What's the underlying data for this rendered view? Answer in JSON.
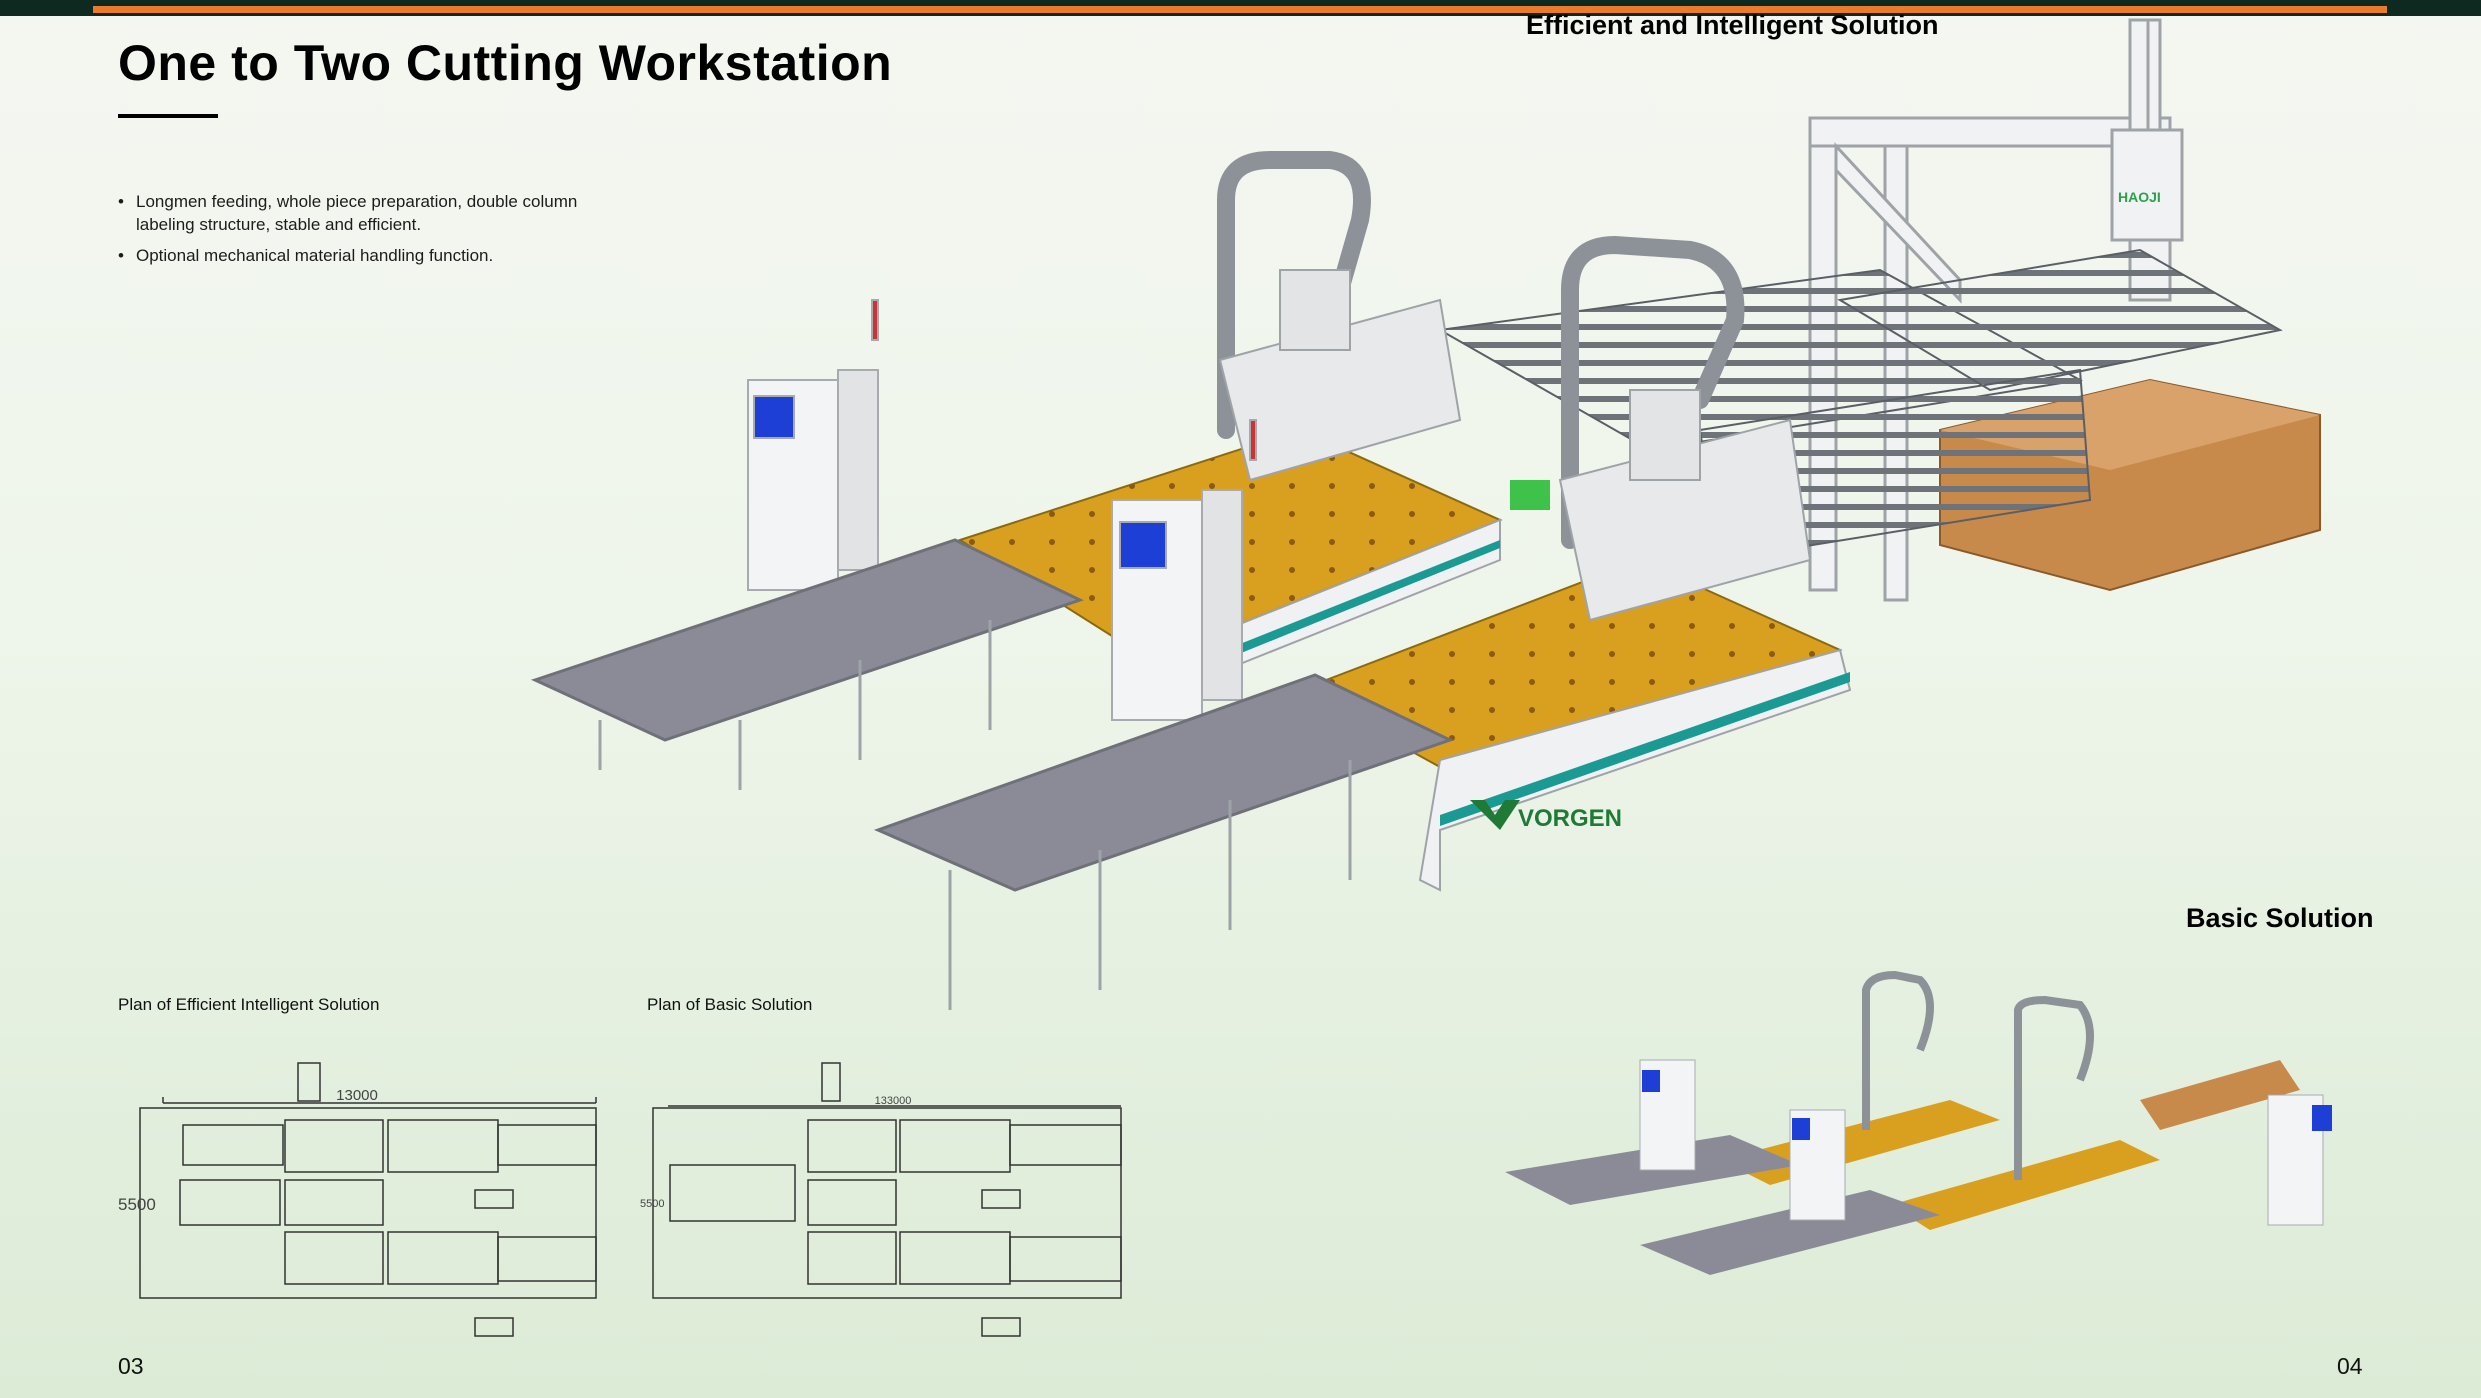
{
  "title": "One to Two Cutting Workstation",
  "bullets": [
    "Longmen feeding, whole piece preparation, double column labeling structure, stable and efficient.",
    "Optional mechanical material handling function."
  ],
  "solutions": {
    "efficient_title": "Efficient and Intelligent Solution",
    "basic_title": "Basic Solution"
  },
  "plans": {
    "efficient": {
      "label": "Plan of Efficient Intelligent Solution",
      "length_dim": "13000",
      "width_dim": "5500"
    },
    "basic": {
      "label": "Plan of Basic Solution",
      "length_dim": "133000",
      "width_dim": "5500"
    }
  },
  "machine": {
    "brand": "VORGEN",
    "gantry_brand": "HAOJI"
  },
  "pages": {
    "left": "03",
    "right": "04"
  },
  "colors": {
    "accent_orange": "#ec7a2c",
    "header_dark": "#0e2a20",
    "table_orange": "#d9a020",
    "belt_gray": "#8b8b97",
    "teal": "#1b9a93",
    "logo_green": "#1f7a36"
  }
}
